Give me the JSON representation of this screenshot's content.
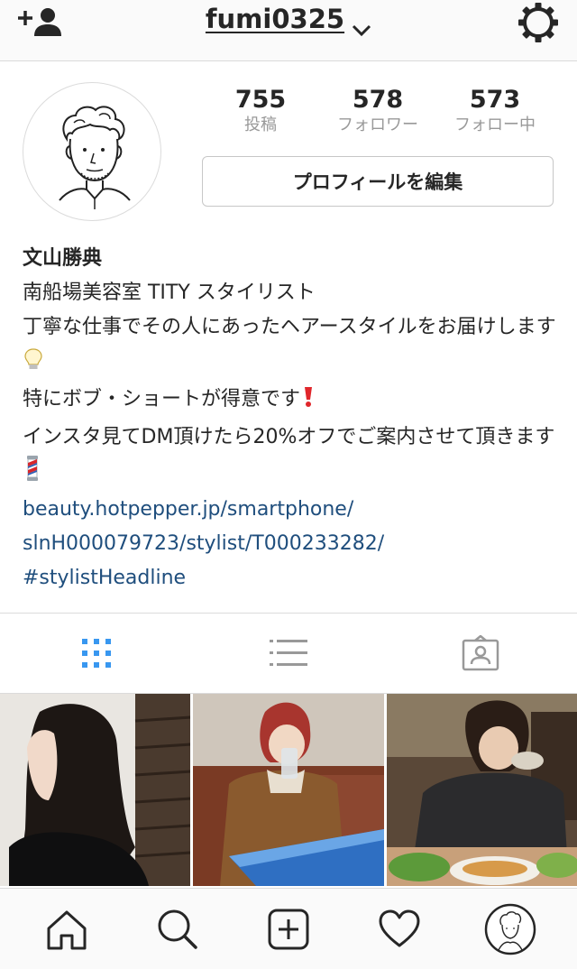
{
  "header": {
    "username": "fumi0325"
  },
  "profile": {
    "stats": [
      {
        "value": "755",
        "label": "投稿"
      },
      {
        "value": "578",
        "label": "フォロワー"
      },
      {
        "value": "573",
        "label": "フォロー中"
      }
    ],
    "edit_label": "プロフィールを編集"
  },
  "bio": {
    "name": "文山勝典",
    "lines": [
      "南船場美容室 TITY スタイリスト",
      "丁寧な仕事でその人にあったヘアースタイルをお届けします",
      "特にボブ・ショートが得意です",
      "インスタ見てDM頂けたら20%オフでご案内させて頂きます"
    ],
    "link_lines": [
      "beauty.hotpepper.jp/smartphone/",
      "slnH000079723/stylist/T000233282/",
      "#stylistHeadline"
    ]
  },
  "colors": {
    "link": "#1f4e7d",
    "tab_active": "#3897f0",
    "tab_inactive": "#999999",
    "border": "#dbdbdb"
  },
  "icons": {
    "top_left": "add-user-icon",
    "top_right": "settings-gear-icon",
    "tabs": [
      "grid-icon",
      "list-icon",
      "tagged-icon"
    ],
    "bottom_nav": [
      "home-icon",
      "search-icon",
      "add-post-icon",
      "heart-icon",
      "profile-avatar-icon"
    ]
  }
}
